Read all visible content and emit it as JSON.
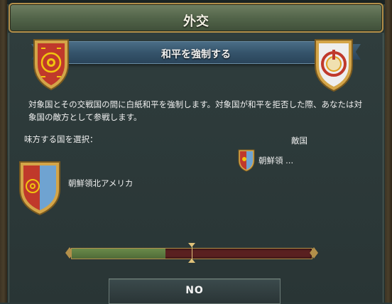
{
  "window": {
    "title": "外交"
  },
  "dialog": {
    "heading": "和平を強制する",
    "description": "対象国とその交戦国の間に白紙和平を強制します。対象国が和平を拒否した際、あなたは対象国の敵方として参戦します。"
  },
  "sides": {
    "ally_label": "味方する国を選択：",
    "enemy_label": "敵国"
  },
  "countries": {
    "enemy_name": "朝鮮領 ...",
    "ally_name": "朝鮮領北アメリカ"
  },
  "balance": {
    "positive_fraction": 0.39,
    "marker_fraction": 0.5
  },
  "buttons": {
    "no_label": "NO"
  },
  "colors": {
    "accent_gold": "#b28f4a",
    "positive": "#5a7a40",
    "negative": "#5a2020",
    "enemy_shield": "#c0392b",
    "ally_shield_blue": "#6fa3d1"
  }
}
